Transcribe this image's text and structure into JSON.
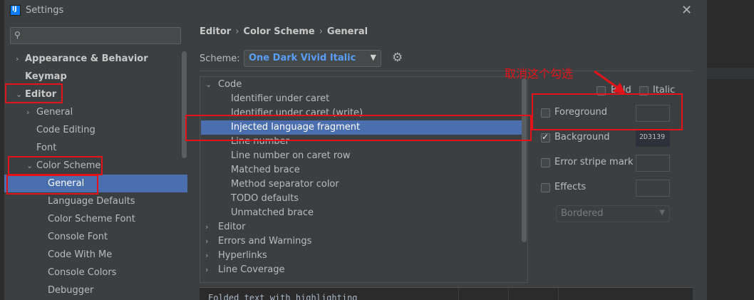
{
  "window": {
    "title": "Settings"
  },
  "left_tree": {
    "items": [
      {
        "label": "Appearance & Behavior",
        "arrow": "›"
      },
      {
        "label": "Keymap",
        "arrow": ""
      },
      {
        "label": "Editor",
        "arrow": "⌄"
      },
      {
        "label": "General",
        "arrow": "›"
      },
      {
        "label": "Code Editing",
        "arrow": ""
      },
      {
        "label": "Font",
        "arrow": ""
      },
      {
        "label": "Color Scheme",
        "arrow": "⌄"
      },
      {
        "label": "General",
        "arrow": ""
      },
      {
        "label": "Language Defaults",
        "arrow": ""
      },
      {
        "label": "Color Scheme Font",
        "arrow": ""
      },
      {
        "label": "Console Font",
        "arrow": ""
      },
      {
        "label": "Code With Me",
        "arrow": ""
      },
      {
        "label": "Console Colors",
        "arrow": ""
      },
      {
        "label": "Debugger",
        "arrow": ""
      }
    ]
  },
  "breadcrumb": {
    "items": [
      "Editor",
      "Color Scheme",
      "General"
    ],
    "separator": "›"
  },
  "scheme": {
    "label": "Scheme:",
    "value": "One Dark Vivid Italic"
  },
  "element_list": {
    "items": [
      {
        "label": "Code",
        "arrow": "⌄"
      },
      {
        "label": "Identifier under caret",
        "arrow": ""
      },
      {
        "label": "Identifier under caret (write)",
        "arrow": ""
      },
      {
        "label": "Injected language fragment",
        "arrow": ""
      },
      {
        "label": "Line number",
        "arrow": ""
      },
      {
        "label": "Line number on caret row",
        "arrow": ""
      },
      {
        "label": "Matched brace",
        "arrow": ""
      },
      {
        "label": "Method separator color",
        "arrow": ""
      },
      {
        "label": "TODO defaults",
        "arrow": ""
      },
      {
        "label": "Unmatched brace",
        "arrow": ""
      },
      {
        "label": "Editor",
        "arrow": "›"
      },
      {
        "label": "Errors and Warnings",
        "arrow": "›"
      },
      {
        "label": "Hyperlinks",
        "arrow": "›"
      },
      {
        "label": "Line Coverage",
        "arrow": "›"
      }
    ]
  },
  "attributes": {
    "bold": "Bold",
    "italic": "Italic",
    "foreground": "Foreground",
    "background": "Background",
    "background_value": "2D3139",
    "error_stripe": "Error stripe mark",
    "effects": "Effects",
    "effect_type": "Bordered"
  },
  "preview": {
    "text": "Folded text with highlighting"
  },
  "annotation": {
    "text": "取消这个勾选"
  },
  "colors": {
    "accent": "#4b6eaf",
    "annotation_red": "#e2141a",
    "scheme_blue": "#589df6"
  }
}
